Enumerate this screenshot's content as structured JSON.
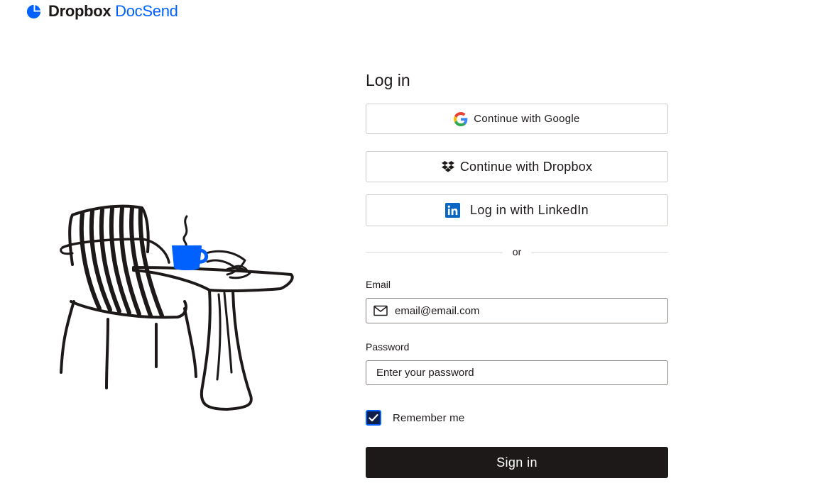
{
  "brand": {
    "name_primary": "Dropbox",
    "name_secondary": "DocSend",
    "accent_color": "#0061fe",
    "text_color": "#1e1919"
  },
  "login": {
    "title": "Log in",
    "google_label": "Continue with Google",
    "dropbox_label": "Continue with Dropbox",
    "linkedin_label": "Log in with LinkedIn",
    "divider_text": "or",
    "email_label": "Email",
    "email_value": "email@email.com",
    "password_label": "Password",
    "password_placeholder": "Enter your password",
    "remember_label": "Remember me",
    "remember_checked": true,
    "signin_label": "Sign in"
  },
  "icons": {
    "logo": "dropbox-docsend-logo-icon",
    "google": "google-icon",
    "dropbox": "dropbox-icon",
    "linkedin": "linkedin-icon",
    "email": "mail-icon",
    "checkbox": "check-icon"
  }
}
